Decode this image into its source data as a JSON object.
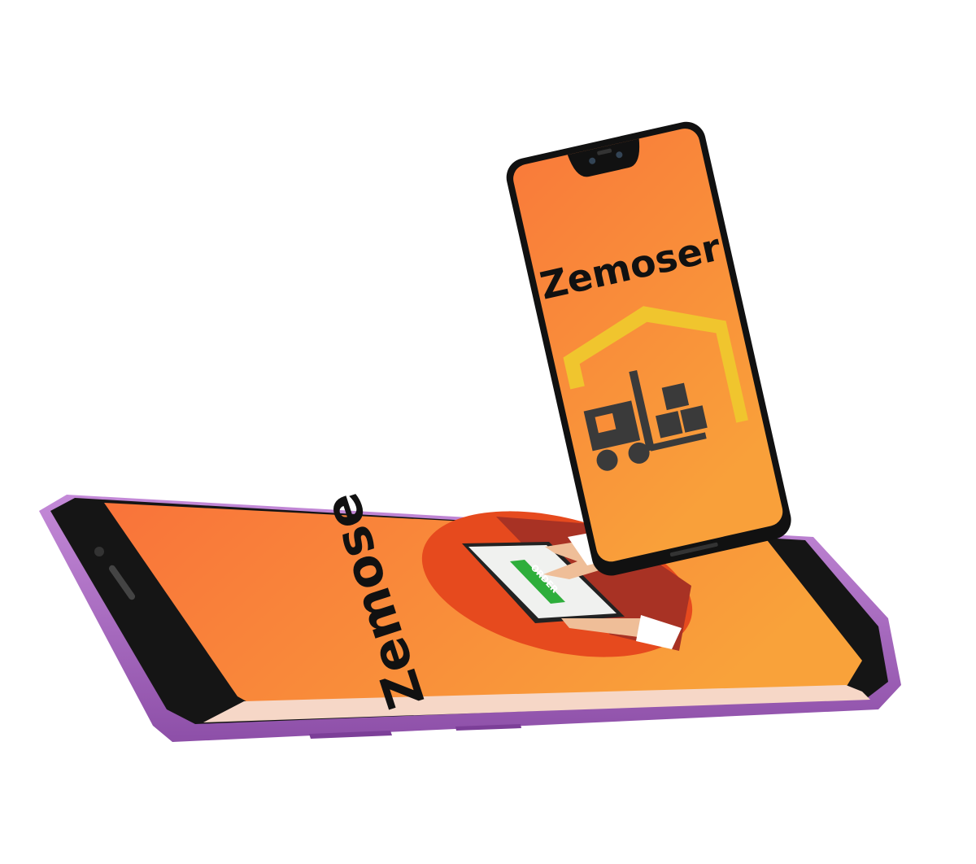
{
  "lying_phone": {
    "brand_text": "Zemose",
    "order_button_label": "ORDER",
    "body_color": "#a86cc1",
    "screen_color": "#f98038"
  },
  "standing_phone": {
    "brand_text": "Zemoser",
    "icon": "warehouse-forklift-icon",
    "roof_color": "#f0c52e",
    "forklift_color": "#3a3a3a",
    "screen_color": "#f98a38"
  }
}
